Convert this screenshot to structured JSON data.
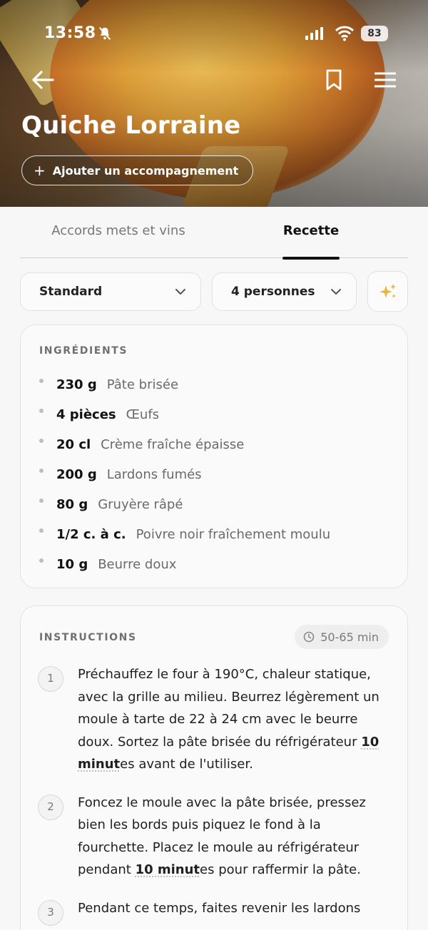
{
  "status_bar": {
    "time": "13:58",
    "battery": "83"
  },
  "recipe": {
    "title": "Quiche Lorraine",
    "add_side_label": "Ajouter un accompagnement"
  },
  "tabs": [
    {
      "label": "Accords mets et vins",
      "active": false
    },
    {
      "label": "Recette",
      "active": true
    }
  ],
  "selectors": {
    "level": "Standard",
    "people": "4 personnes"
  },
  "ingredients": {
    "heading": "INGRÉDIENTS",
    "items": [
      {
        "qty": "230 g",
        "name": "Pâte brisée"
      },
      {
        "qty": "4 pièces",
        "name": "Œufs"
      },
      {
        "qty": "20 cl",
        "name": "Crème fraîche épaisse"
      },
      {
        "qty": "200 g",
        "name": "Lardons fumés"
      },
      {
        "qty": "80 g",
        "name": "Gruyère râpé"
      },
      {
        "qty": "1/2 c. à c.",
        "name": "Poivre noir fraîchement moulu"
      },
      {
        "qty": "10 g",
        "name": "Beurre doux"
      }
    ]
  },
  "instructions": {
    "heading": "INSTRUCTIONS",
    "duration": "50-65 min",
    "steps": [
      {
        "num": "1",
        "before": "Préchauffez le four à 190°C, chaleur statique, avec la grille au milieu. Beurrez légèrement un moule à tarte de 22 à 24 cm avec le beurre doux. Sortez la pâte brisée du réfrigérateur ",
        "highlight": "10 minut",
        "after": "es avant de l'utiliser."
      },
      {
        "num": "2",
        "before": "Foncez le moule avec la pâte brisée, pressez bien les bords puis piquez le fond à la fourchette. Placez le moule au réfrigérateur pendant ",
        "highlight": "10 minut",
        "after": "es pour raffermir la pâte."
      },
      {
        "num": "3",
        "before": "Pendant ce temps, faites revenir les lardons",
        "highlight": "",
        "after": ""
      }
    ]
  },
  "colors": {
    "accent_sparkle": "#e8b43a",
    "active_tab": "#111111"
  }
}
